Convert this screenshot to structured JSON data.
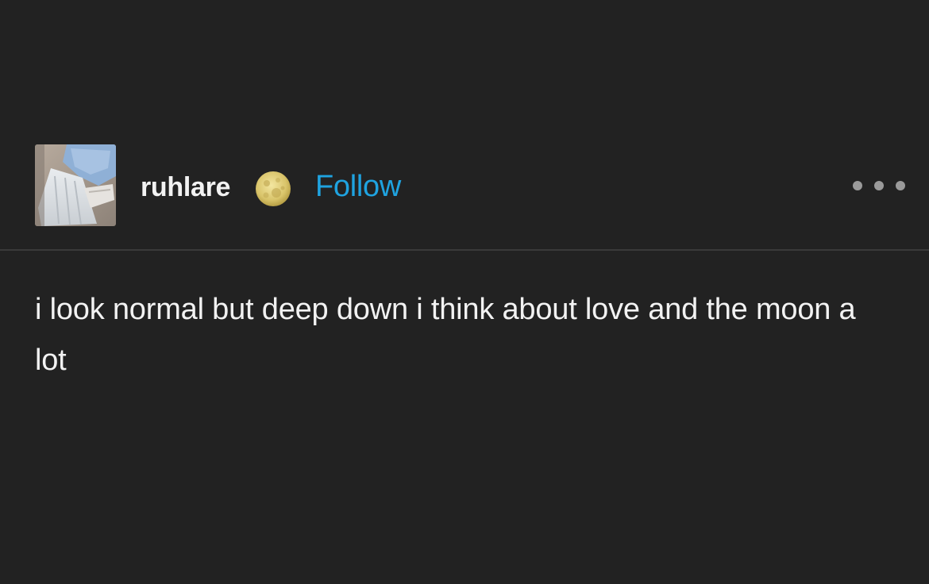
{
  "post": {
    "author": {
      "username": "ruhlare",
      "badge_icon": "moon-icon",
      "avatar_icon": "avatar-photo"
    },
    "follow_label": "Follow",
    "more_icon": "more-dots-icon",
    "body_text": "i look normal but deep down i think about love and the moon a lot"
  },
  "colors": {
    "background": "#222222",
    "text": "#f2f2f2",
    "follow": "#1fa3e0",
    "divider": "#3a3a3a",
    "dots": "#9a9a9a"
  }
}
